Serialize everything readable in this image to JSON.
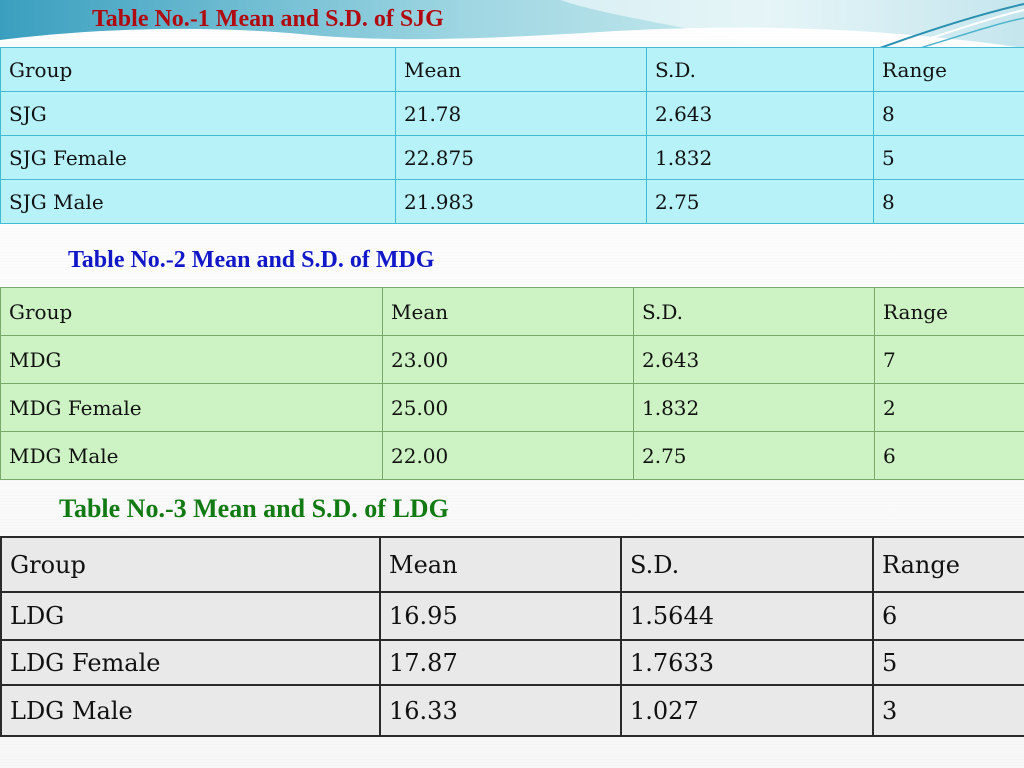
{
  "colors": {
    "table1_fill": "#b7f2f8",
    "table2_fill": "#cdf2c4",
    "table3_fill": "#e9e9e9",
    "title1": "#b00a10",
    "title2": "#1218c8",
    "title3": "#127a12"
  },
  "tables": [
    {
      "title": "Table No.-1 Mean and S.D. of SJG",
      "header": [
        "Group",
        "Mean",
        "S.D.",
        "Range"
      ],
      "rows": [
        [
          "SJG",
          "21.78",
          "2.643",
          "8"
        ],
        [
          "SJG Female",
          "22.875",
          "1.832",
          "5"
        ],
        [
          "SJG Male",
          "21.983",
          "2.75",
          "8"
        ]
      ]
    },
    {
      "title": "Table No.-2 Mean and S.D. of MDG",
      "header": [
        "Group",
        "Mean",
        "S.D.",
        "Range"
      ],
      "rows": [
        [
          "MDG",
          "23.00",
          "2.643",
          "7"
        ],
        [
          "MDG Female",
          "25.00",
          "1.832",
          "2"
        ],
        [
          "MDG Male",
          "22.00",
          "2.75",
          "6"
        ]
      ]
    },
    {
      "title": "Table No.-3 Mean and S.D. of LDG",
      "header": [
        "Group",
        "Mean",
        "S.D.",
        "Range"
      ],
      "rows": [
        [
          "LDG",
          "16.95",
          "1.5644",
          "6"
        ],
        [
          "LDG Female",
          "17.87",
          "1.7633",
          "5"
        ],
        [
          "LDG Male",
          "16.33",
          "1.027",
          "3"
        ]
      ]
    }
  ]
}
